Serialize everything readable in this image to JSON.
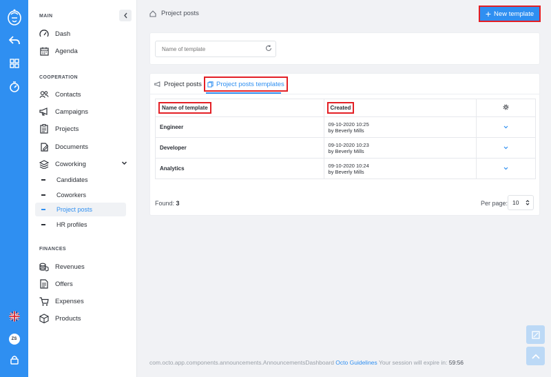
{
  "rail": {
    "icons": [
      "logo-icon",
      "back-icon",
      "grid-icon",
      "timer-icon",
      "uk-flag-icon",
      "avatar",
      "lock-icon"
    ],
    "avatar_initials": "ZS"
  },
  "sidebar": {
    "sections": {
      "main": "MAIN",
      "cooperation": "COOPERATION",
      "finances": "FINANCES"
    },
    "main_items": [
      {
        "label": "Dash",
        "icon": "gauge-icon"
      },
      {
        "label": "Agenda",
        "icon": "calendar-icon"
      }
    ],
    "cooperation_items": [
      {
        "label": "Contacts",
        "icon": "contacts-icon"
      },
      {
        "label": "Campaigns",
        "icon": "megaphone-icon"
      },
      {
        "label": "Projects",
        "icon": "clipboard-icon"
      },
      {
        "label": "Documents",
        "icon": "document-icon"
      },
      {
        "label": "Coworking",
        "icon": "layers-icon"
      }
    ],
    "coworking_sub": [
      {
        "label": "Candidates"
      },
      {
        "label": "Coworkers"
      },
      {
        "label": "Project posts"
      },
      {
        "label": "HR profiles"
      }
    ],
    "finance_items": [
      {
        "label": "Revenues",
        "icon": "coins-icon"
      },
      {
        "label": "Offers",
        "icon": "offer-icon"
      },
      {
        "label": "Expenses",
        "icon": "cart-icon"
      },
      {
        "label": "Products",
        "icon": "box-icon"
      }
    ]
  },
  "header": {
    "breadcrumb": "Project posts",
    "new_button": "New template"
  },
  "filter": {
    "placeholder": "Name of template"
  },
  "tabs": [
    {
      "label": "Project posts",
      "active": false
    },
    {
      "label": "Project posts templates",
      "active": true
    }
  ],
  "table": {
    "headers": {
      "name": "Name of template",
      "created": "Created"
    },
    "rows": [
      {
        "name": "Engineer",
        "date": "09-10-2020 10:25",
        "by": "by Beverly Mills"
      },
      {
        "name": "Developer",
        "date": "09-10-2020 10:23",
        "by": "by Beverly Mills"
      },
      {
        "name": "Analytics",
        "date": "09-10-2020 10:24",
        "by": "by Beverly Mills"
      }
    ]
  },
  "pagination": {
    "found_label": "Found:",
    "found_count": "3",
    "per_page_label": "Per page:",
    "per_page_value": "10"
  },
  "footer": {
    "component": "com.octo.app.components.announcements.AnnouncementsDashboard",
    "link": "Octo Guidelines",
    "session_text": "Your session will expire in:",
    "timer": "59:56"
  },
  "colors": {
    "accent": "#2f8ff1",
    "highlight": "#e31e24"
  }
}
